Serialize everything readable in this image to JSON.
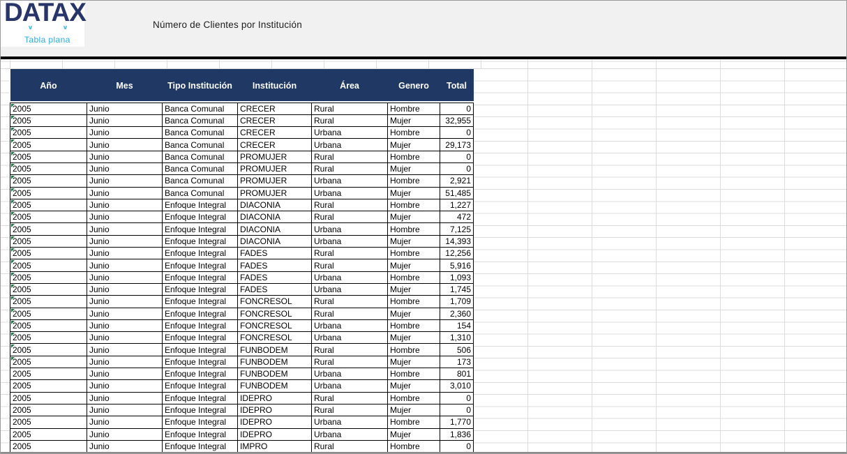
{
  "brand": {
    "logo_text": "DATAX",
    "tagline": "Tabla plana",
    "logo_color": "#28356A",
    "tagline_color": "#29ABE2"
  },
  "header": {
    "title": "Número de Clientes por Institución"
  },
  "colors": {
    "table_header_bg": "#203864",
    "error_indicator_green": "#217346",
    "banner_bg": "#f1f1f1",
    "bottom_band_gray": "#8c8c8c"
  },
  "table": {
    "columns": [
      "Año",
      "Mes",
      "Tipo Institución",
      "Institución",
      "Área",
      "Genero",
      "Total"
    ],
    "rows": [
      {
        "cells": [
          "2005",
          "Junio",
          "Banca Comunal",
          "CRECER",
          "Rural",
          "Hombre",
          "0"
        ],
        "error_indicator": true
      },
      {
        "cells": [
          "2005",
          "Junio",
          "Banca Comunal",
          "CRECER",
          "Rural",
          "Mujer",
          "32,955"
        ],
        "error_indicator": true
      },
      {
        "cells": [
          "2005",
          "Junio",
          "Banca Comunal",
          "CRECER",
          "Urbana",
          "Hombre",
          "0"
        ],
        "error_indicator": true
      },
      {
        "cells": [
          "2005",
          "Junio",
          "Banca Comunal",
          "CRECER",
          "Urbana",
          "Mujer",
          "29,173"
        ],
        "error_indicator": true
      },
      {
        "cells": [
          "2005",
          "Junio",
          "Banca Comunal",
          "PROMUJER",
          "Rural",
          "Hombre",
          "0"
        ],
        "error_indicator": true
      },
      {
        "cells": [
          "2005",
          "Junio",
          "Banca Comunal",
          "PROMUJER",
          "Rural",
          "Mujer",
          "0"
        ],
        "error_indicator": true
      },
      {
        "cells": [
          "2005",
          "Junio",
          "Banca Comunal",
          "PROMUJER",
          "Urbana",
          "Hombre",
          "2,921"
        ],
        "error_indicator": true
      },
      {
        "cells": [
          "2005",
          "Junio",
          "Banca Comunal",
          "PROMUJER",
          "Urbana",
          "Mujer",
          "51,485"
        ],
        "error_indicator": true
      },
      {
        "cells": [
          "2005",
          "Junio",
          "Enfoque Integral",
          "DIACONIA",
          "Rural",
          "Hombre",
          "1,227"
        ],
        "error_indicator": true
      },
      {
        "cells": [
          "2005",
          "Junio",
          "Enfoque Integral",
          "DIACONIA",
          "Rural",
          "Mujer",
          "472"
        ],
        "error_indicator": true
      },
      {
        "cells": [
          "2005",
          "Junio",
          "Enfoque Integral",
          "DIACONIA",
          "Urbana",
          "Hombre",
          "7,125"
        ],
        "error_indicator": true
      },
      {
        "cells": [
          "2005",
          "Junio",
          "Enfoque Integral",
          "DIACONIA",
          "Urbana",
          "Mujer",
          "14,393"
        ],
        "error_indicator": true
      },
      {
        "cells": [
          "2005",
          "Junio",
          "Enfoque Integral",
          "FADES",
          "Rural",
          "Hombre",
          "12,256"
        ],
        "error_indicator": true
      },
      {
        "cells": [
          "2005",
          "Junio",
          "Enfoque Integral",
          "FADES",
          "Rural",
          "Mujer",
          "5,916"
        ],
        "error_indicator": true
      },
      {
        "cells": [
          "2005",
          "Junio",
          "Enfoque Integral",
          "FADES",
          "Urbana",
          "Hombre",
          "1,093"
        ],
        "error_indicator": true
      },
      {
        "cells": [
          "2005",
          "Junio",
          "Enfoque Integral",
          "FADES",
          "Urbana",
          "Mujer",
          "1,745"
        ],
        "error_indicator": true
      },
      {
        "cells": [
          "2005",
          "Junio",
          "Enfoque Integral",
          "FONCRESOL",
          "Rural",
          "Hombre",
          "1,709"
        ],
        "error_indicator": true
      },
      {
        "cells": [
          "2005",
          "Junio",
          "Enfoque Integral",
          "FONCRESOL",
          "Rural",
          "Mujer",
          "2,360"
        ],
        "error_indicator": true
      },
      {
        "cells": [
          "2005",
          "Junio",
          "Enfoque Integral",
          "FONCRESOL",
          "Urbana",
          "Hombre",
          "154"
        ],
        "error_indicator": true
      },
      {
        "cells": [
          "2005",
          "Junio",
          "Enfoque Integral",
          "FONCRESOL",
          "Urbana",
          "Mujer",
          "1,310"
        ],
        "error_indicator": true
      },
      {
        "cells": [
          "2005",
          "Junio",
          "Enfoque Integral",
          "FUNBODEM",
          "Rural",
          "Hombre",
          "506"
        ],
        "error_indicator": true
      },
      {
        "cells": [
          "2005",
          "Junio",
          "Enfoque Integral",
          "FUNBODEM",
          "Rural",
          "Mujer",
          "173"
        ],
        "error_indicator": true
      },
      {
        "cells": [
          "2005",
          "Junio",
          "Enfoque Integral",
          "FUNBODEM",
          "Urbana",
          "Hombre",
          "801"
        ],
        "error_indicator": false
      },
      {
        "cells": [
          "2005",
          "Junio",
          "Enfoque Integral",
          "FUNBODEM",
          "Urbana",
          "Mujer",
          "3,010"
        ],
        "error_indicator": false
      },
      {
        "cells": [
          "2005",
          "Junio",
          "Enfoque Integral",
          "IDEPRO",
          "Rural",
          "Hombre",
          "0"
        ],
        "error_indicator": false
      },
      {
        "cells": [
          "2005",
          "Junio",
          "Enfoque Integral",
          "IDEPRO",
          "Rural",
          "Mujer",
          "0"
        ],
        "error_indicator": false
      },
      {
        "cells": [
          "2005",
          "Junio",
          "Enfoque Integral",
          "IDEPRO",
          "Urbana",
          "Hombre",
          "1,770"
        ],
        "error_indicator": false
      },
      {
        "cells": [
          "2005",
          "Junio",
          "Enfoque Integral",
          "IDEPRO",
          "Urbana",
          "Mujer",
          "1,836"
        ],
        "error_indicator": false
      },
      {
        "cells": [
          "2005",
          "Junio",
          "Enfoque Integral",
          "IMPRO",
          "Rural",
          "Hombre",
          "0"
        ],
        "error_indicator": false
      }
    ]
  }
}
